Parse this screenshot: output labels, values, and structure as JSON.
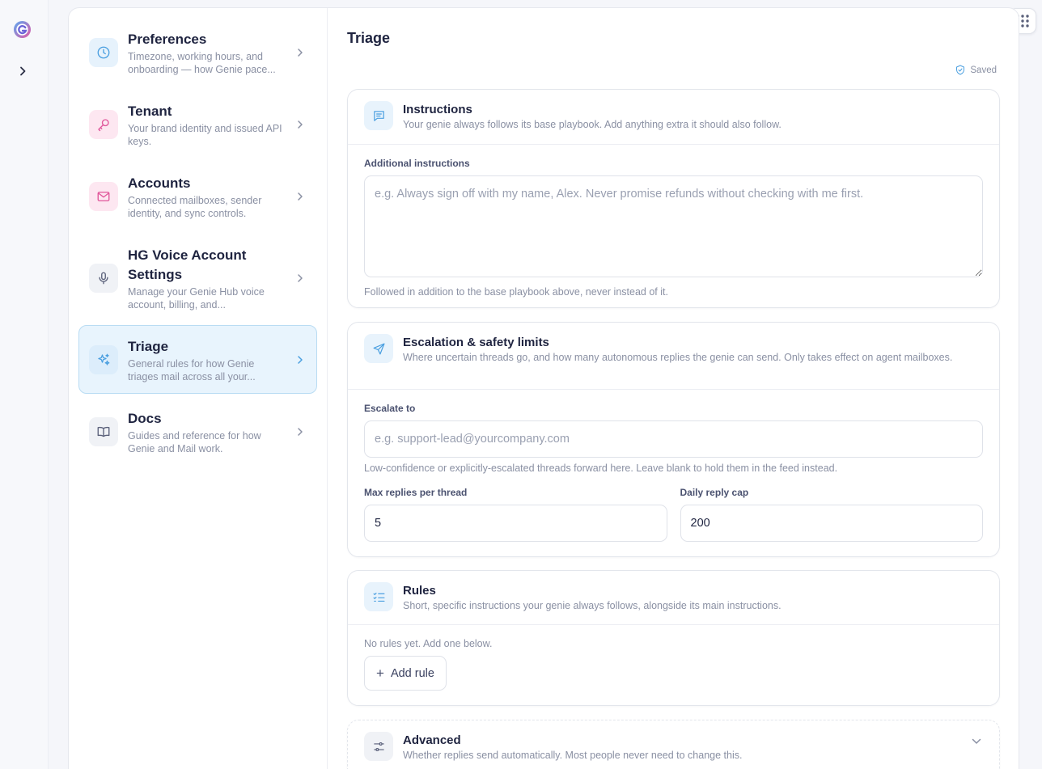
{
  "nav": {
    "items": [
      {
        "title": "Preferences",
        "desc": "Timezone, working hours, and onboarding — how Genie pace..."
      },
      {
        "title": "Tenant",
        "desc": "Your brand identity and issued API keys."
      },
      {
        "title": "Accounts",
        "desc": "Connected mailboxes, sender identity, and sync controls."
      },
      {
        "title": "HG Voice Account Settings",
        "desc": "Manage your Genie Hub voice account, billing, and..."
      },
      {
        "title": "Triage",
        "desc": "General rules for how Genie triages mail across all your..."
      },
      {
        "title": "Docs",
        "desc": "Guides and reference for how Genie and Mail work."
      }
    ]
  },
  "page": {
    "title": "Triage",
    "saved": "Saved"
  },
  "instructions": {
    "title": "Instructions",
    "sub": "Your genie always follows its base playbook. Add anything extra it should also follow.",
    "field_label": "Additional instructions",
    "placeholder": "e.g. Always sign off with my name, Alex. Never promise refunds without checking with me first.",
    "help": "Followed in addition to the base playbook above, never instead of it."
  },
  "escalation": {
    "title": "Escalation & safety limits",
    "sub": "Where uncertain threads go, and how many autonomous replies the genie can send. Only takes effect on agent mailboxes.",
    "escalate_label": "Escalate to",
    "escalate_placeholder": "e.g. support-lead@yourcompany.com",
    "escalate_help": "Low-confidence or explicitly-escalated threads forward here. Leave blank to hold them in the feed instead.",
    "max_label": "Max replies per thread",
    "max_value": "5",
    "cap_label": "Daily reply cap",
    "cap_value": "200"
  },
  "rules": {
    "title": "Rules",
    "sub": "Short, specific instructions your genie always follows, alongside its main instructions.",
    "empty": "No rules yet. Add one below.",
    "add_label": "Add rule"
  },
  "advanced": {
    "title": "Advanced",
    "sub": "Whether replies send automatically. Most people never need to change this."
  },
  "colors": {
    "accent": "#4a9fe0",
    "active_bg": "#e8f4fd",
    "active_border": "#b9dcf3",
    "pink": "#e0559a"
  }
}
